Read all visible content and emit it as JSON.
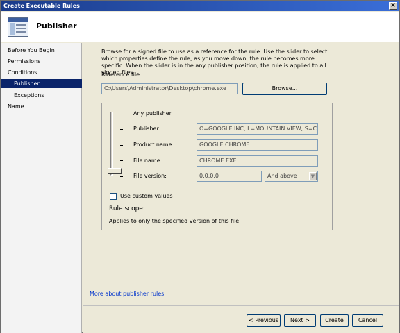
{
  "window": {
    "title": "Create Executable Rules",
    "close_glyph": "×"
  },
  "header": {
    "title": "Publisher"
  },
  "sidebar": {
    "items": [
      {
        "label": "Before You Begin"
      },
      {
        "label": "Permissions"
      },
      {
        "label": "Conditions"
      },
      {
        "label": "Publisher"
      },
      {
        "label": "Exceptions"
      },
      {
        "label": "Name"
      }
    ]
  },
  "main": {
    "intro": "Browse for a signed file to use as a reference for the rule. Use the slider to select which properties define the rule; as you move down, the rule becomes more specific. When the slider is in the any publisher position, the rule is applied to all signed files.",
    "reference_label": "Reference file:",
    "reference_value": "C:\\Users\\Administrator\\Desktop\\chrome.exe",
    "browse_label": "Browse...",
    "any_publisher": "Any publisher",
    "publisher_label": "Publisher:",
    "publisher_value": "O=GOOGLE INC, L=MOUNTAIN VIEW, S=CALIF",
    "product_label": "Product name:",
    "product_value": "GOOGLE CHROME",
    "file_label": "File name:",
    "file_value": "CHROME.EXE",
    "version_label": "File version:",
    "version_value": "0.0.0.0",
    "version_option": "And above",
    "custom_values_label": "Use custom values",
    "custom_values_checked": false,
    "rule_scope_label": "Rule scope:",
    "rule_scope_text": "Applies to only the specified version of this file.",
    "more_link": "More about publisher rules"
  },
  "footer": {
    "previous": "< Previous",
    "next": "Next >",
    "create": "Create",
    "cancel": "Cancel"
  },
  "colors": {
    "title_bar": "#1a3b8a",
    "selected_nav": "#0a246a",
    "link": "#0033cc",
    "dialog_bg": "#ece9d8"
  }
}
